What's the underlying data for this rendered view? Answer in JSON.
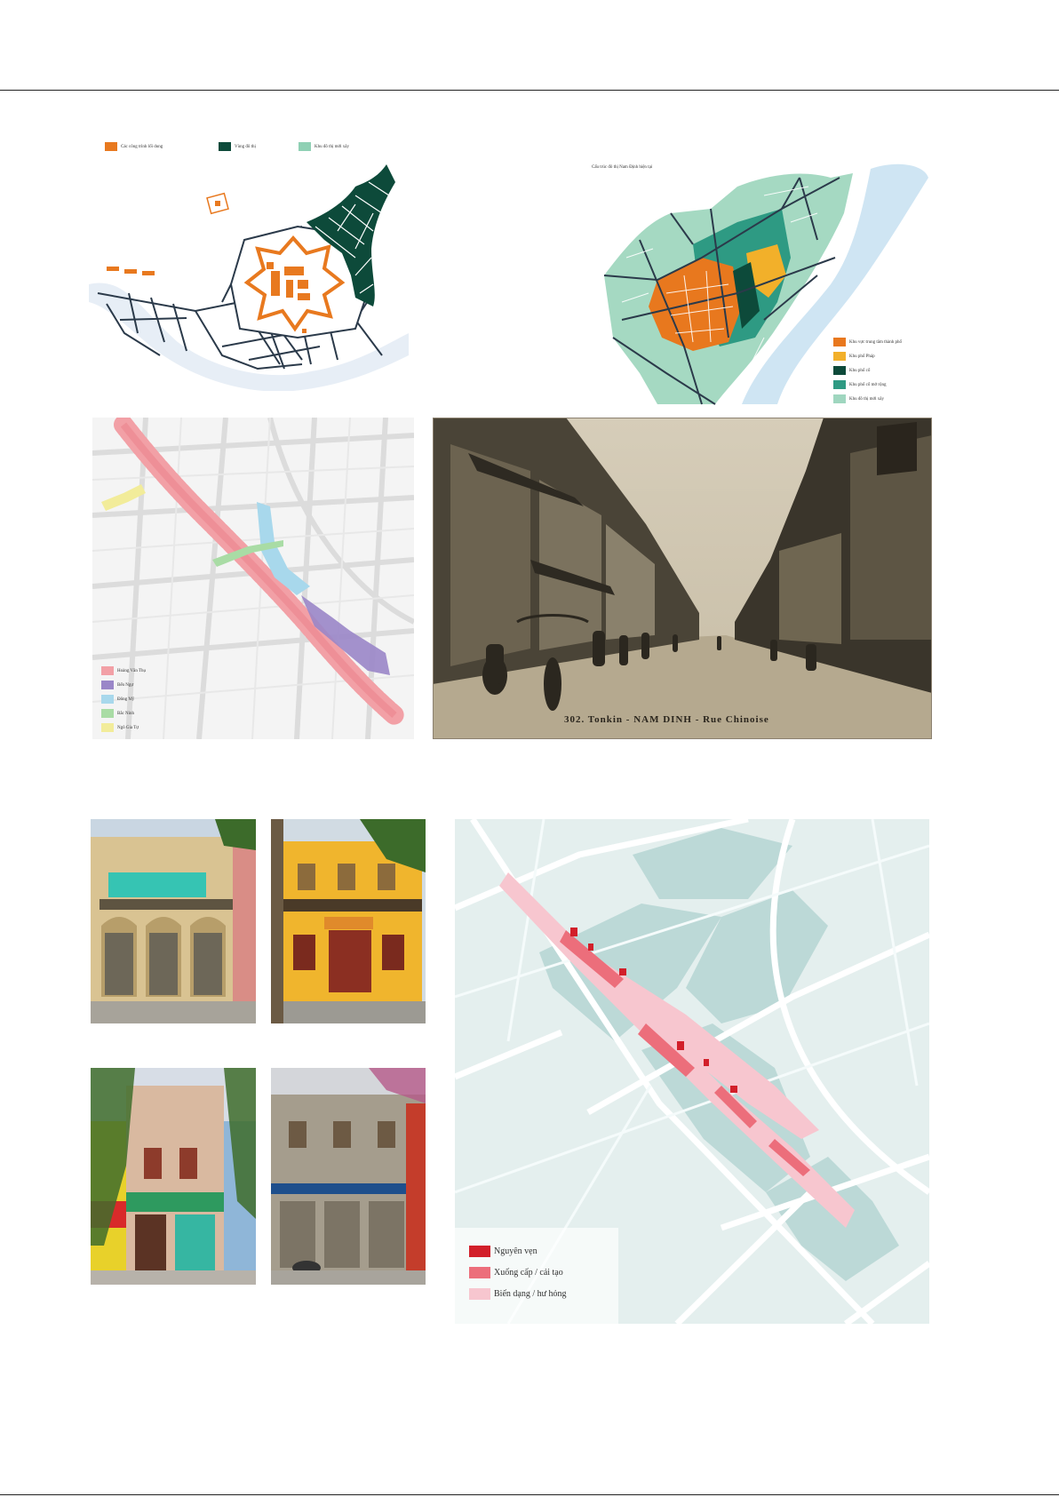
{
  "map1": {
    "legend": [
      {
        "label": "Các công trình lối dung",
        "color": "#e8791f"
      },
      {
        "label": "Vùng đô thị",
        "color": "#0d4a3a"
      },
      {
        "label": "Khu đô thị mới xây",
        "color": "#8fd0b4"
      }
    ]
  },
  "map2": {
    "title": "Cấu trúc đô thị Nam Định hiện tại",
    "legend": [
      {
        "label": "Khu vực trung tâm thành phố",
        "color": "#e8781e"
      },
      {
        "label": "Khu phố Pháp",
        "color": "#f2b02a"
      },
      {
        "label": "Khu phố cổ",
        "color": "#0d4a3a"
      },
      {
        "label": "Khu phố cổ mở rộng",
        "color": "#2e9a83"
      },
      {
        "label": "Khu đô thị mới xây",
        "color": "#9fd6bf"
      }
    ]
  },
  "map3": {
    "legend": [
      {
        "label": "Hoàng Văn Thụ",
        "color": "#f2a0a6"
      },
      {
        "label": "Bến Ngự",
        "color": "#9a86c8"
      },
      {
        "label": "Đông Mỹ",
        "color": "#a8d8ec"
      },
      {
        "label": "Bắc Ninh",
        "color": "#a9dca5"
      },
      {
        "label": "Ngô Gia Tự",
        "color": "#f2ec9a"
      }
    ]
  },
  "photo": {
    "caption": "302. Tonkin - NAM DINH - Rue Chinoise"
  },
  "map4": {
    "legend": [
      {
        "label": "Nguyên vẹn",
        "color": "#d21f2a"
      },
      {
        "label": "Xuống cấp / cải tạo",
        "color": "#ec6e7b"
      },
      {
        "label": "Biến dạng / hư hỏng",
        "color": "#f7c6cf"
      }
    ]
  },
  "colors": {
    "accent_orange": "#e8791f",
    "dark_green": "#0d4a3a",
    "light_green": "#8fd0b4",
    "sepia": "#b9ad97",
    "map_bg": "#dcebea"
  }
}
